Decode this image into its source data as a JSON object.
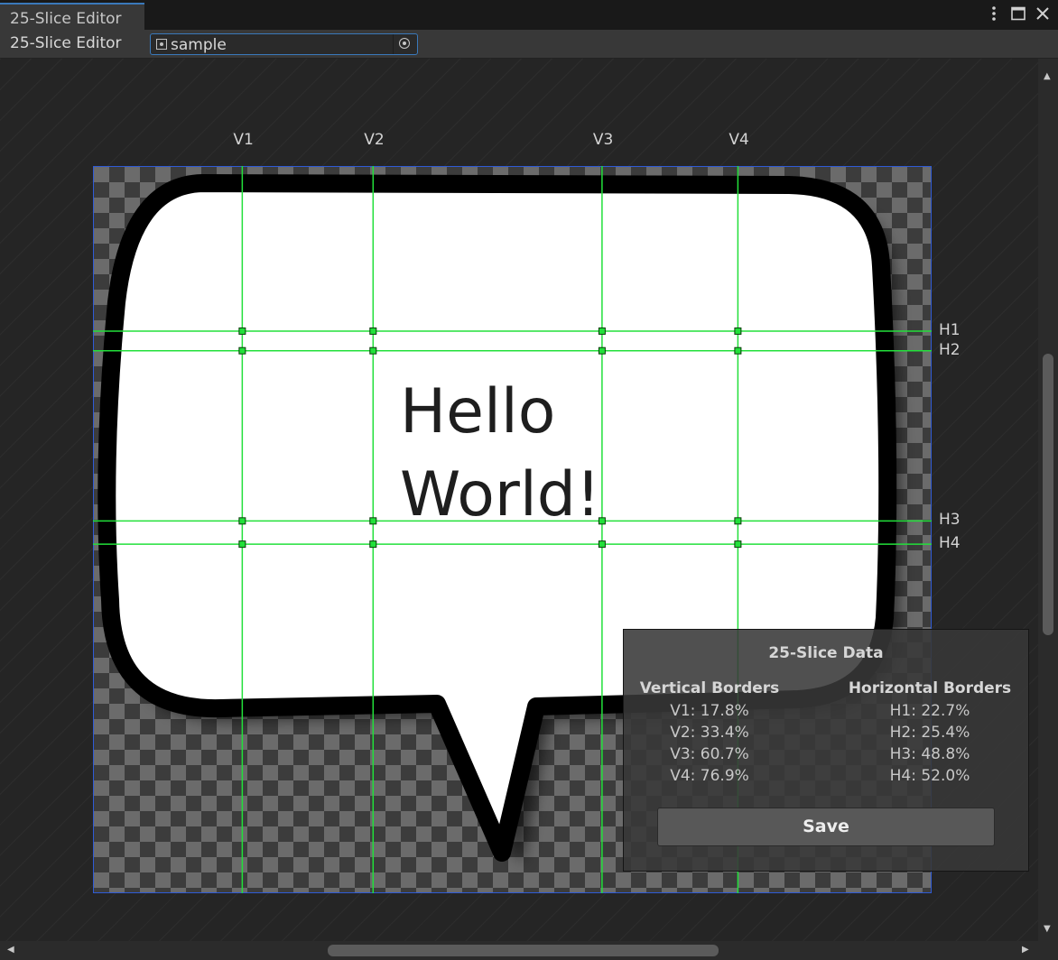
{
  "window": {
    "tab_title": "25-Slice Editor",
    "buttons": [
      "menu-icon",
      "maximize-icon",
      "close-icon"
    ]
  },
  "toolbar": {
    "label": "25-Slice Editor",
    "object_field": {
      "value": "sample",
      "icon": "sprite-icon",
      "picker_icon": "target-picker-icon"
    }
  },
  "canvas": {
    "sprite_text": "Hello\nWorld!",
    "vertical_guides": [
      {
        "label": "V1",
        "value": 17.8
      },
      {
        "label": "V2",
        "value": 33.4
      },
      {
        "label": "V3",
        "value": 60.7
      },
      {
        "label": "V4",
        "value": 76.9
      }
    ],
    "horizontal_guides": [
      {
        "label": "H1",
        "value": 22.7
      },
      {
        "label": "H2",
        "value": 25.4
      },
      {
        "label": "H3",
        "value": 48.8
      },
      {
        "label": "H4",
        "value": 52.0
      }
    ],
    "guide_color": "#22e03a",
    "sprite_border_color": "#2f5bd6"
  },
  "panel": {
    "title": "25-Slice Data",
    "vertical_header": "Vertical Borders",
    "horizontal_header": "Horizontal Borders",
    "vertical": [
      "V1: 17.8%",
      "V2: 33.4%",
      "V3: 60.7%",
      "V4: 76.9%"
    ],
    "horizontal": [
      "H1: 22.7%",
      "H2: 25.4%",
      "H3: 48.8%",
      "H4: 52.0%"
    ],
    "save_label": "Save"
  },
  "colors": {
    "accent": "#3a79bb",
    "background": "#282828"
  }
}
